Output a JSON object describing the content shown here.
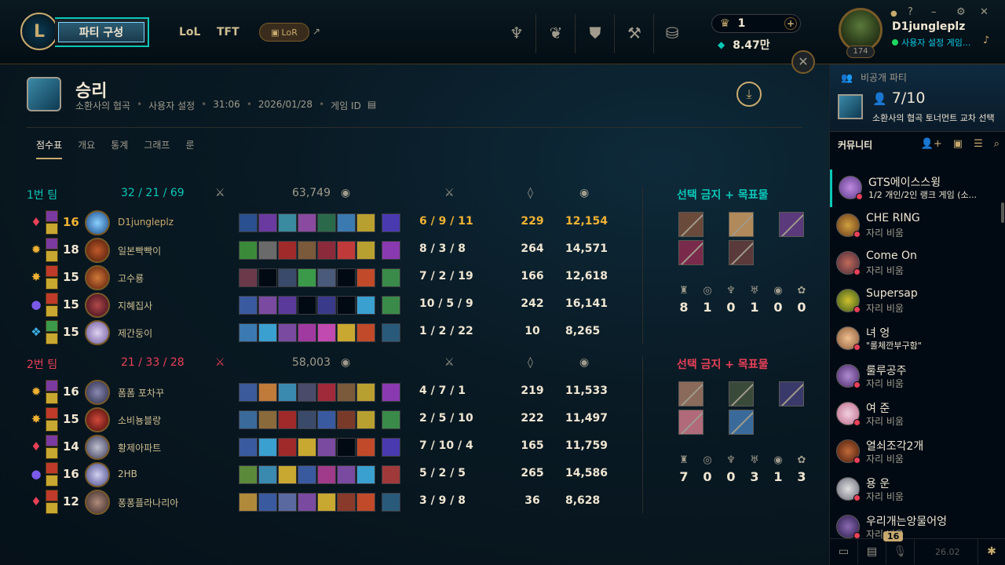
{
  "nav": {
    "party_button": "파티 구성",
    "lol": "LoL",
    "tft": "TFT",
    "lor": "LoR",
    "blue_essence": "1",
    "rp": "8.47만"
  },
  "profile": {
    "name": "D1jungleplz",
    "status": "사용자 설정 게임...",
    "level": "174"
  },
  "match": {
    "result": "승리",
    "map": "소환사의 협곡",
    "mode": "사용자 설정",
    "duration": "31:06",
    "date": "2026/01/28",
    "game_id_label": "게임 ID"
  },
  "tabs": [
    "점수표",
    "개요",
    "통계",
    "그래프",
    "룬"
  ],
  "teams": [
    {
      "name": "1번 팀",
      "kda": "32 / 21 / 69",
      "gold": "63,749",
      "bans_label": "선택 금지 + 목표물",
      "objectives": [
        "8",
        "1",
        "0",
        "1",
        "0",
        "0"
      ],
      "players": [
        {
          "level": "16",
          "name": "D1jungleplz",
          "kda": "6 / 9 / 11",
          "cs": "229",
          "gold": "12,154",
          "me": true
        },
        {
          "level": "18",
          "name": "일본빡빡이",
          "kda": "8 / 3 / 8",
          "cs": "264",
          "gold": "14,571",
          "me": false
        },
        {
          "level": "15",
          "name": "고수룡",
          "kda": "7 / 2 / 19",
          "cs": "166",
          "gold": "12,618",
          "me": false
        },
        {
          "level": "15",
          "name": "지혜집사",
          "kda": "10 / 5 / 9",
          "cs": "242",
          "gold": "16,141",
          "me": false
        },
        {
          "level": "15",
          "name": "제간둥이",
          "kda": "1 / 2 / 22",
          "cs": "10",
          "gold": "8,265",
          "me": false
        }
      ]
    },
    {
      "name": "2번 팀",
      "kda": "21 / 33 / 28",
      "gold": "58,003",
      "bans_label": "선택 금지 + 목표물",
      "objectives": [
        "7",
        "0",
        "0",
        "3",
        "1",
        "3"
      ],
      "players": [
        {
          "level": "16",
          "name": "폼폼 포차꾸",
          "kda": "4 / 7 / 1",
          "cs": "219",
          "gold": "11,533",
          "me": false
        },
        {
          "level": "15",
          "name": "소비뇽블랑",
          "kda": "2 / 5 / 10",
          "cs": "222",
          "gold": "11,497",
          "me": false
        },
        {
          "level": "14",
          "name": "황제아파트",
          "kda": "7 / 10 / 4",
          "cs": "165",
          "gold": "11,759",
          "me": false
        },
        {
          "level": "16",
          "name": "2HB",
          "kda": "5 / 2 / 5",
          "cs": "265",
          "gold": "14,586",
          "me": false
        },
        {
          "level": "12",
          "name": "퐁퐁플라나리아",
          "kda": "3 / 9 / 8",
          "cs": "36",
          "gold": "8,628",
          "me": false
        }
      ]
    }
  ],
  "social": {
    "lobby_title": "비공개 파티",
    "lobby_count": "7/10",
    "lobby_mode": "소환사의 협곡 토너먼트 교차 선택",
    "community": "커뮤니티",
    "friends": [
      {
        "name": "GTS에이스스윙",
        "status": "1/2 개인/2인 랭크 게임 (소..."
      },
      {
        "name": "CHE RING",
        "status": "자리 비움"
      },
      {
        "name": "Come On",
        "status": "자리 비움"
      },
      {
        "name": "Supersap",
        "status": "자리 비움"
      },
      {
        "name": "녀 엉",
        "status": "\"롤체깐부구함\""
      },
      {
        "name": "룰루공주",
        "status": "자리 비움"
      },
      {
        "name": "여 준",
        "status": "자리 비움"
      },
      {
        "name": "열쇠조각2개",
        "status": "자리 비움"
      },
      {
        "name": "용 운",
        "status": "자리 비움"
      },
      {
        "name": "우리개는앙물어엉",
        "status": "자리 비움"
      }
    ],
    "chat_badge": "16",
    "version": "26.02"
  }
}
